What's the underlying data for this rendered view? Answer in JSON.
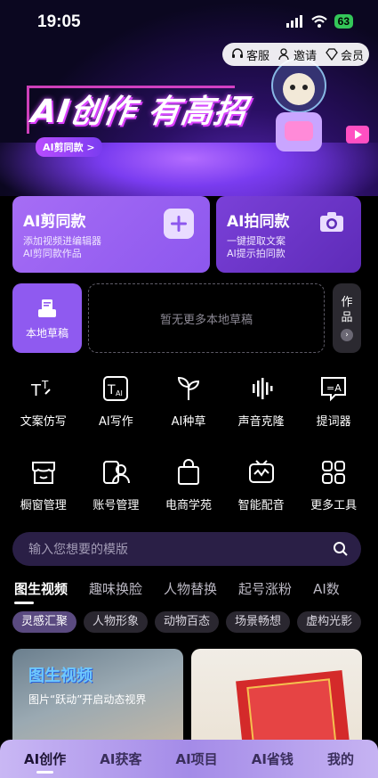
{
  "status_bar": {
    "time": "19:05",
    "battery": "63"
  },
  "top_bar": {
    "service": "客服",
    "invite": "邀请",
    "member": "会员"
  },
  "hero": {
    "title": "AI创作 有高招",
    "badge": "AI剪同款 >"
  },
  "cards": {
    "primary": {
      "title": "AI剪同款",
      "line1": "添加视频进编辑器",
      "line2": "AI剪同款作品"
    },
    "secondary": {
      "title": "AI拍同款",
      "line1": "一键提取文案",
      "line2": "AI提示拍同款"
    }
  },
  "drafts": {
    "local_label": "本地草稿",
    "empty_text": "暂无更多本地草稿",
    "works_label": "作品"
  },
  "tools": [
    {
      "label": "文案仿写",
      "icon": "text-rewrite-icon"
    },
    {
      "label": "AI写作",
      "icon": "ai-writing-icon"
    },
    {
      "label": "AI种草",
      "icon": "sprout-icon"
    },
    {
      "label": "声音克隆",
      "icon": "voice-clone-icon"
    },
    {
      "label": "提词器",
      "icon": "teleprompter-icon"
    },
    {
      "label": "橱窗管理",
      "icon": "storefront-icon"
    },
    {
      "label": "账号管理",
      "icon": "account-manage-icon"
    },
    {
      "label": "电商学苑",
      "icon": "shopping-bag-icon"
    },
    {
      "label": "智能配音",
      "icon": "tv-voice-icon"
    },
    {
      "label": "更多工具",
      "icon": "grid-more-icon"
    }
  ],
  "search": {
    "placeholder": "输入您想要的模版"
  },
  "category_tabs": [
    "图生视频",
    "趣味换脸",
    "人物替换",
    "起号涨粉",
    "AI数"
  ],
  "chips": [
    "灵感汇聚",
    "人物形象",
    "动物百态",
    "场景畅想",
    "虚构光影"
  ],
  "feed": {
    "card1_title": "图生视频",
    "card1_sub": "图片“跃动”开启动态视界"
  },
  "bottom_nav": [
    "AI创作",
    "AI获客",
    "AI项目",
    "AI省钱",
    "我的"
  ]
}
